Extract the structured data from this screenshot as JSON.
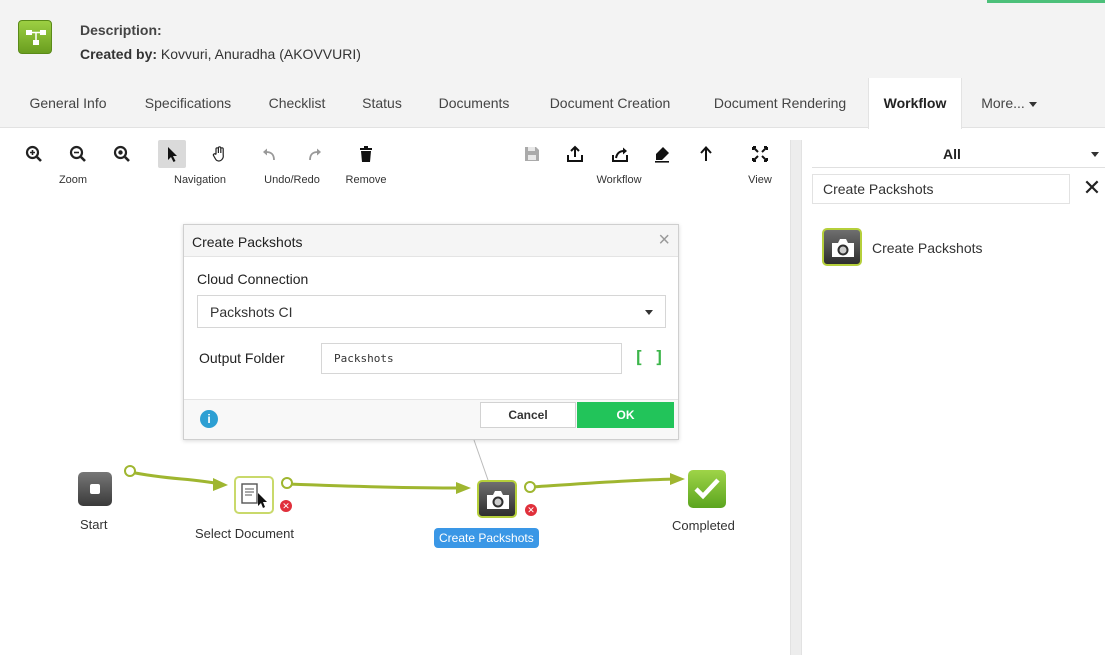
{
  "header": {
    "description_label": "Description:",
    "created_by_label": "Created by:",
    "created_by_value": "Kovvuri, Anuradha (AKOVVURI)"
  },
  "tabs": [
    {
      "label": "General Info"
    },
    {
      "label": "Specifications"
    },
    {
      "label": "Checklist"
    },
    {
      "label": "Status"
    },
    {
      "label": "Documents"
    },
    {
      "label": "Document Creation"
    },
    {
      "label": "Document Rendering"
    },
    {
      "label": "Workflow",
      "active": true
    },
    {
      "label": "More..."
    }
  ],
  "toolbar": {
    "groups": [
      {
        "label": "Zoom"
      },
      {
        "label": "Navigation"
      },
      {
        "label": "Undo/Redo"
      },
      {
        "label": "Remove"
      },
      {
        "label": "Workflow"
      },
      {
        "label": "View"
      }
    ]
  },
  "dialog": {
    "title": "Create Packshots",
    "cloud_connection_label": "Cloud Connection",
    "cloud_connection_value": "Packshots CI",
    "output_folder_label": "Output Folder",
    "output_folder_value": "Packshots",
    "brackets": "[ ]",
    "cancel_label": "Cancel",
    "ok_label": "OK",
    "info_icon": "i"
  },
  "workflow": {
    "nodes": [
      {
        "label": "Start"
      },
      {
        "label": "Select Document"
      },
      {
        "label": "Create Packshots",
        "selected": true
      },
      {
        "label": "Completed"
      }
    ]
  },
  "right_panel": {
    "filter_value": "All",
    "search_value": "Create Packshots",
    "clear_symbol": "✕",
    "results": [
      {
        "label": "Create Packshots"
      }
    ]
  },
  "colors": {
    "accent_green": "#22c45a",
    "link_line": "#9fb630",
    "selection_blue": "#3a97e6",
    "error_red": "#e0303b"
  }
}
